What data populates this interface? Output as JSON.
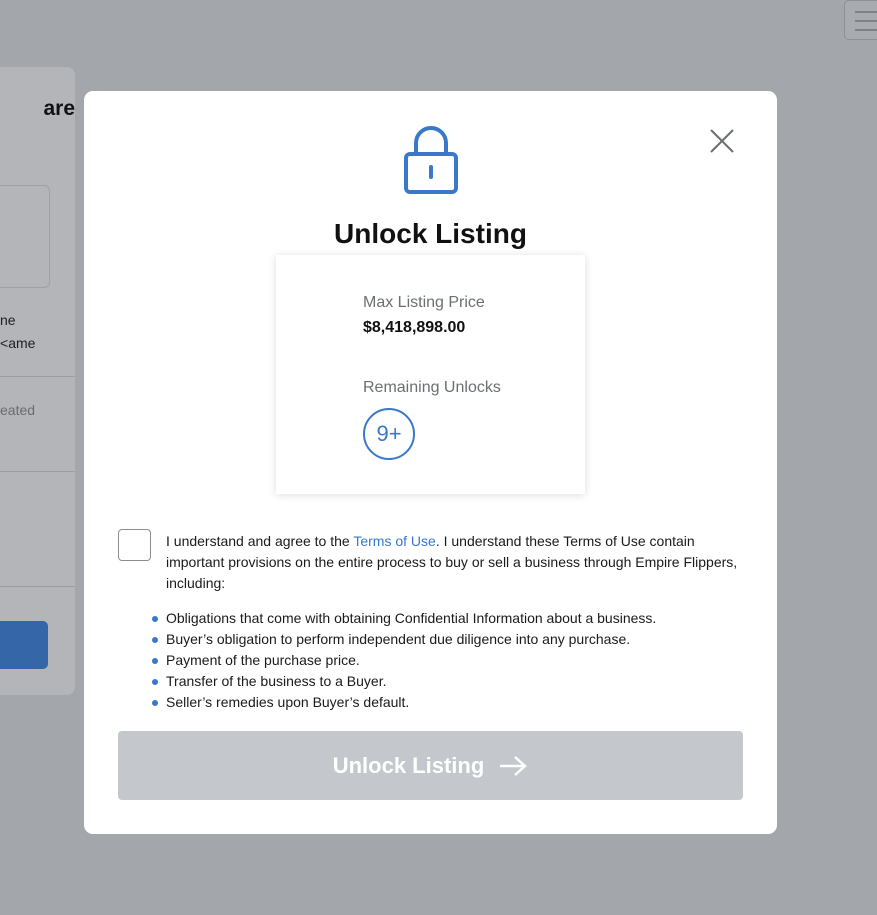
{
  "background": {
    "heading_fragment": "are",
    "line1_fragment": "ne",
    "line2_fragment": "ame>",
    "muted_fragment": "eated"
  },
  "modal": {
    "title": "Unlock Listing",
    "icons": {
      "main": "lock-icon",
      "close": "close-icon"
    },
    "info": {
      "max_price_label": "Max Listing Price",
      "max_price_value": "$8,418,898.00",
      "remaining_label": "Remaining Unlocks",
      "remaining_value": "9+"
    },
    "terms": {
      "prefix": "I understand and agree to the ",
      "link_text": "Terms of Use",
      "suffix": ". I understand these Terms of Use contain important provisions on the entire process to buy or sell a business through Empire Flippers, including:",
      "checked": false
    },
    "provisions": [
      "Obligations that come with obtaining Confidential Information about a business.",
      "Buyer’s obligation to perform independent due diligence into any purchase.",
      "Payment of the purchase price.",
      "Transfer of the business to a Buyer.",
      "Seller’s remedies upon Buyer’s default."
    ],
    "button_label": "Unlock Listing",
    "button_icon": "arrow-right-icon"
  },
  "colors": {
    "accent": "#3a78c9",
    "overlay": "#a3a6aa",
    "button_disabled": "#c4c8cc"
  }
}
